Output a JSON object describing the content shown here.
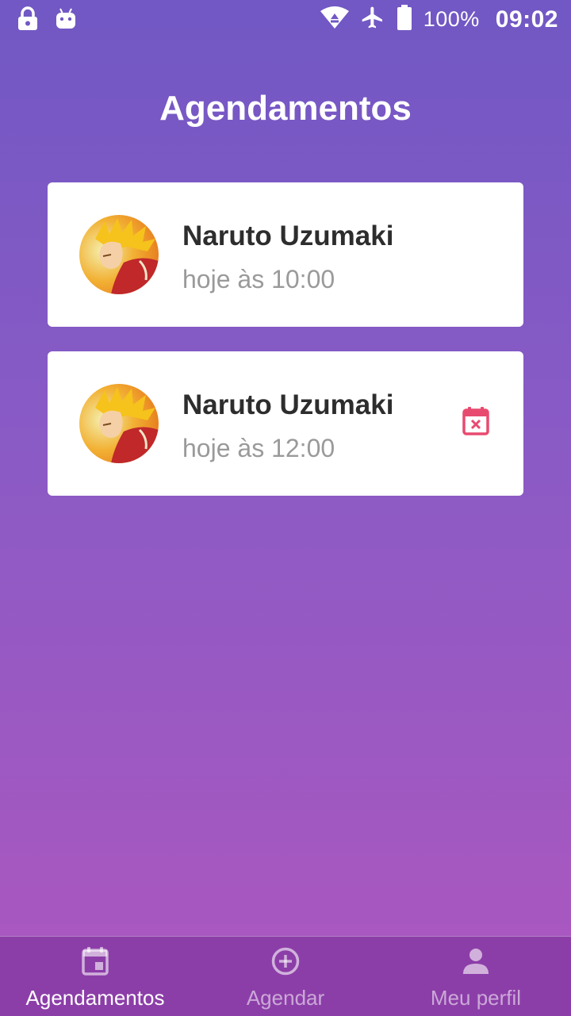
{
  "status_bar": {
    "battery_text": "100%",
    "time": "09:02",
    "icons": [
      "lock-icon",
      "android-icon",
      "wifi-icon",
      "airplane-icon",
      "battery-icon"
    ]
  },
  "page": {
    "title": "Agendamentos"
  },
  "appointments": [
    {
      "name": "Naruto Uzumaki",
      "time": "hoje às 10:00",
      "avatar": "avatar-naruto"
    },
    {
      "name": "Naruto Uzumaki",
      "time": "hoje às 12:00",
      "avatar": "avatar-naruto",
      "action_icon": "calendar-cancel-icon"
    }
  ],
  "bottom_nav": {
    "items": [
      {
        "label": "Agendamentos",
        "icon": "calendar-icon",
        "active": true
      },
      {
        "label": "Agendar",
        "icon": "add-circle-icon",
        "active": false
      },
      {
        "label": "Meu perfil",
        "icon": "person-icon",
        "active": false
      }
    ]
  },
  "colors": {
    "gradient_top": "#7158c4",
    "gradient_bottom": "#ab58bf",
    "nav_background": "#8c3ea8",
    "accent_cancel": "#e84a6f",
    "name_text": "#2d2d2d",
    "time_text": "#9a9a9a"
  }
}
